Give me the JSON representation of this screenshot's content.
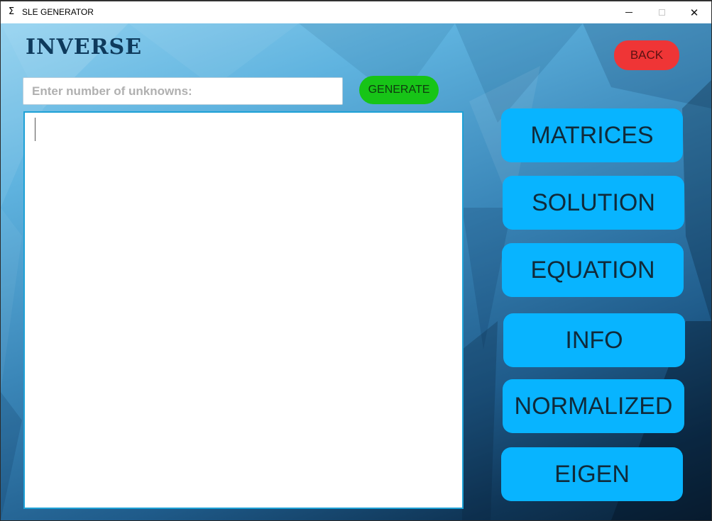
{
  "window": {
    "app_icon": "Σ",
    "title": "SLE GENERATOR",
    "controls": {
      "minimize": "minimize-icon",
      "maximize": "maximize-icon",
      "close": "close-icon",
      "close_glyph": "✕"
    }
  },
  "page": {
    "title": "INVERSE"
  },
  "back_button": {
    "label": "BACK",
    "color": "#ef3536"
  },
  "unknowns_input": {
    "value": "",
    "placeholder": "Enter number of unknowns:"
  },
  "generate_button": {
    "label": "GENERATE",
    "color": "#17c417"
  },
  "output_area": {
    "value": ""
  },
  "nav": {
    "accent": "#08b4ff",
    "items": [
      {
        "label": "MATRICES"
      },
      {
        "label": "SOLUTION"
      },
      {
        "label": "EQUATION"
      },
      {
        "label": "INFO"
      },
      {
        "label": "NORMALIZED"
      },
      {
        "label": "EIGEN"
      }
    ]
  }
}
